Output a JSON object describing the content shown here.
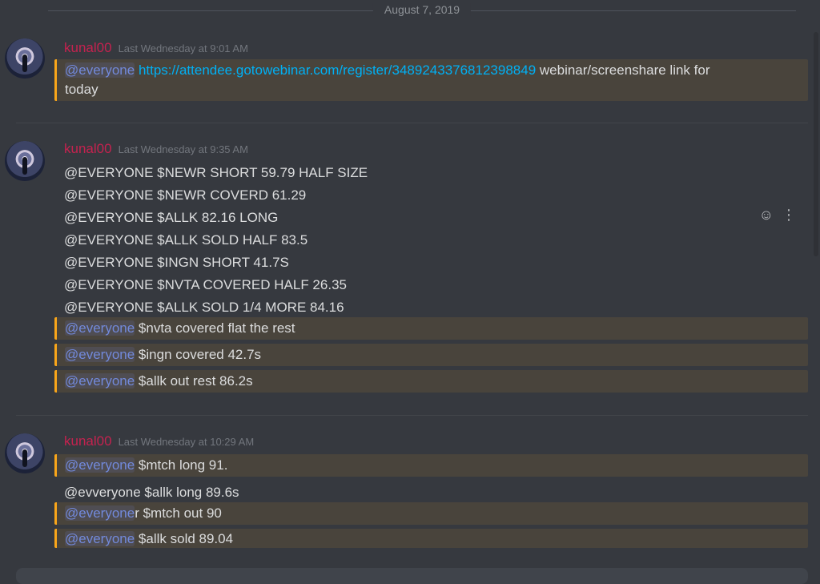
{
  "date_divider": "August 7, 2019",
  "groups": [
    {
      "username": "kunal00",
      "timestamp": "Last Wednesday at 9:01 AM",
      "mention_line": {
        "mention": "@everyone",
        "link": "https://attendee.gotowebinar.com/register/3489243376812398849",
        "text_a": "webinar/screenshare link for",
        "text_b": "today"
      }
    },
    {
      "username": "kunal00",
      "timestamp": "Last Wednesday at 9:35 AM",
      "lines": [
        "@EVERYONE $NEWR SHORT 59.79 HALF SIZE",
        "@EVERYONE $NEWR COVERD 61.29",
        "@EVERYONE $ALLK 82.16 LONG",
        "@EVERYONE $ALLK SOLD HALF 83.5",
        "@EVERYONE $INGN SHORT 41.7S",
        "@EVERYONE $NVTA COVERED HALF 26.35",
        "@EVERYONE $ALLK SOLD 1/4 MORE 84.16"
      ],
      "mentions": [
        {
          "mention": "@everyone",
          "text": " $nvta covered flat the rest"
        },
        {
          "mention": "@everyone",
          "text": " $ingn covered 42.7s"
        },
        {
          "mention": "@everyone",
          "text": " $allk out rest 86.2s"
        }
      ],
      "hover_icons": [
        "add-reaction-icon",
        "more-options-icon"
      ]
    },
    {
      "username": "kunal00",
      "timestamp": "Last Wednesday at 10:29 AM",
      "m1": {
        "mention": "@everyone",
        "text": " $mtch long 91."
      },
      "plain": "@evveryone $allk long 89.6s",
      "m2": {
        "mention": "@everyone",
        "text": "r $mtch out 90"
      },
      "m3": {
        "mention": "@everyone",
        "text": " $allk sold 89.04"
      }
    }
  ],
  "colors": {
    "background": "#36393f",
    "username": "#c5224f",
    "mention": "#7289da",
    "mention_highlight_bg": "#49443c",
    "mention_bar": "#faa61a",
    "link": "#00b0f4"
  }
}
